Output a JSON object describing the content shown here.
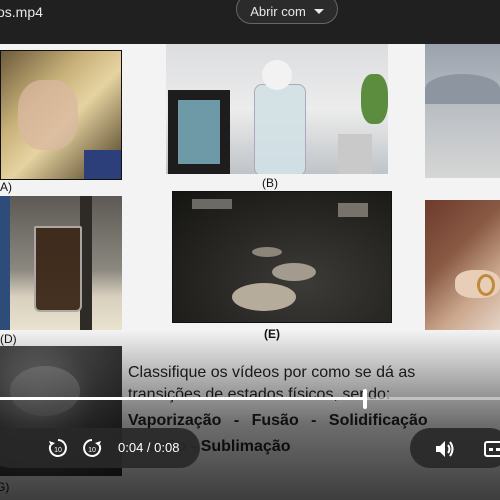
{
  "header": {
    "filename": "os.mp4",
    "open_with_label": "Abrir com"
  },
  "figures": {
    "a": "A)",
    "b": "(B)",
    "d": "(D)",
    "e": "(E)",
    "g": "G)"
  },
  "question": {
    "line1": "Classifique os vídeos por como se dá as",
    "line2": "transições de estados físicos, sendo:",
    "line3": "Vaporização - Fusão - Solidificação",
    "line4": "ação - Sublimação"
  },
  "player": {
    "time_display": "0:04 / 0:08",
    "progress": 0.73,
    "rewind_seconds": "10",
    "forward_seconds": "10"
  },
  "colors": {
    "accent": "#ffffff",
    "toolbar": "#202020"
  },
  "icons": {
    "rewind": "rewind-10-icon",
    "forward": "forward-10-icon",
    "volume": "volume-icon",
    "captions": "captions-icon",
    "caret": "chevron-down-icon"
  }
}
